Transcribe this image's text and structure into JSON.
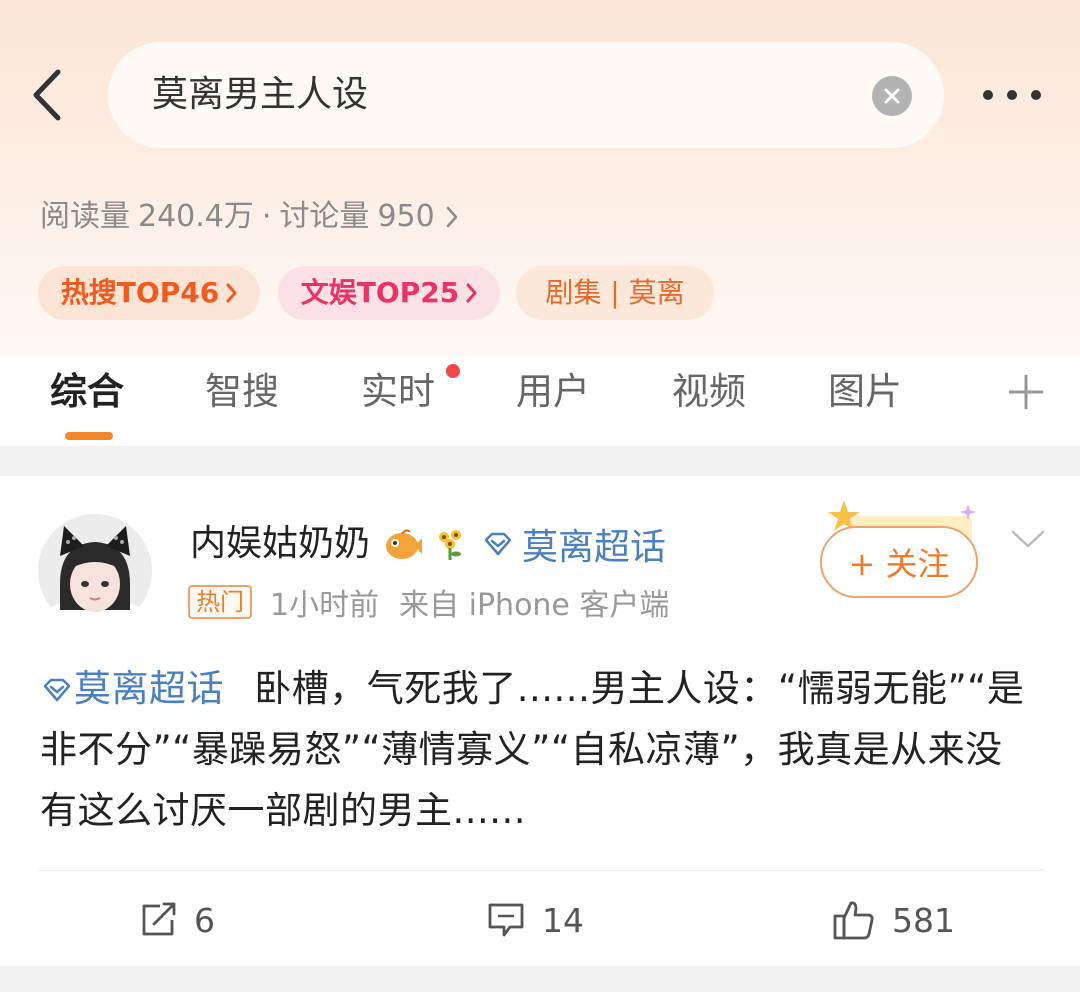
{
  "search": {
    "query": "莫离男主人设"
  },
  "stats": {
    "reads_label": "阅读量",
    "reads": "240.4万",
    "separator": "·",
    "discussions_label": "讨论量",
    "discussions": "950"
  },
  "tags": [
    {
      "label": "热搜TOP46",
      "color": "#f05a1e"
    },
    {
      "label": "文娱TOP25",
      "color": "#e8336a"
    },
    {
      "label": "剧集 | 莫离",
      "color": "#e36a2a"
    }
  ],
  "tabs": [
    "综合",
    "智搜",
    "实时",
    "用户",
    "视频",
    "图片"
  ],
  "accent_color": "#f4862c",
  "post": {
    "username": "内娱姑奶奶",
    "user_topic": "莫离超话",
    "hot_badge": "热门",
    "time": "1小时前",
    "source": "来自 iPhone 客户端",
    "follow_label": "+ 关注",
    "inline_topic": "莫离超话",
    "text": "卧槽，气死我了......男主人设：“懦弱无能”“是非不分”“暴躁易怒”“薄情寡义”“自私凉薄”，我真是从来没有这么讨厌一部剧的男主......",
    "reposts": "6",
    "comments": "14",
    "likes": "581"
  },
  "icons": [
    "back-arrow-icon",
    "clear-icon",
    "more-icon",
    "chevron-right-icon",
    "plus-icon",
    "fish-emoji-icon",
    "sunflower-emoji-icon",
    "super-topic-icon",
    "chevron-down-icon",
    "repost-icon",
    "comment-icon",
    "like-icon"
  ]
}
